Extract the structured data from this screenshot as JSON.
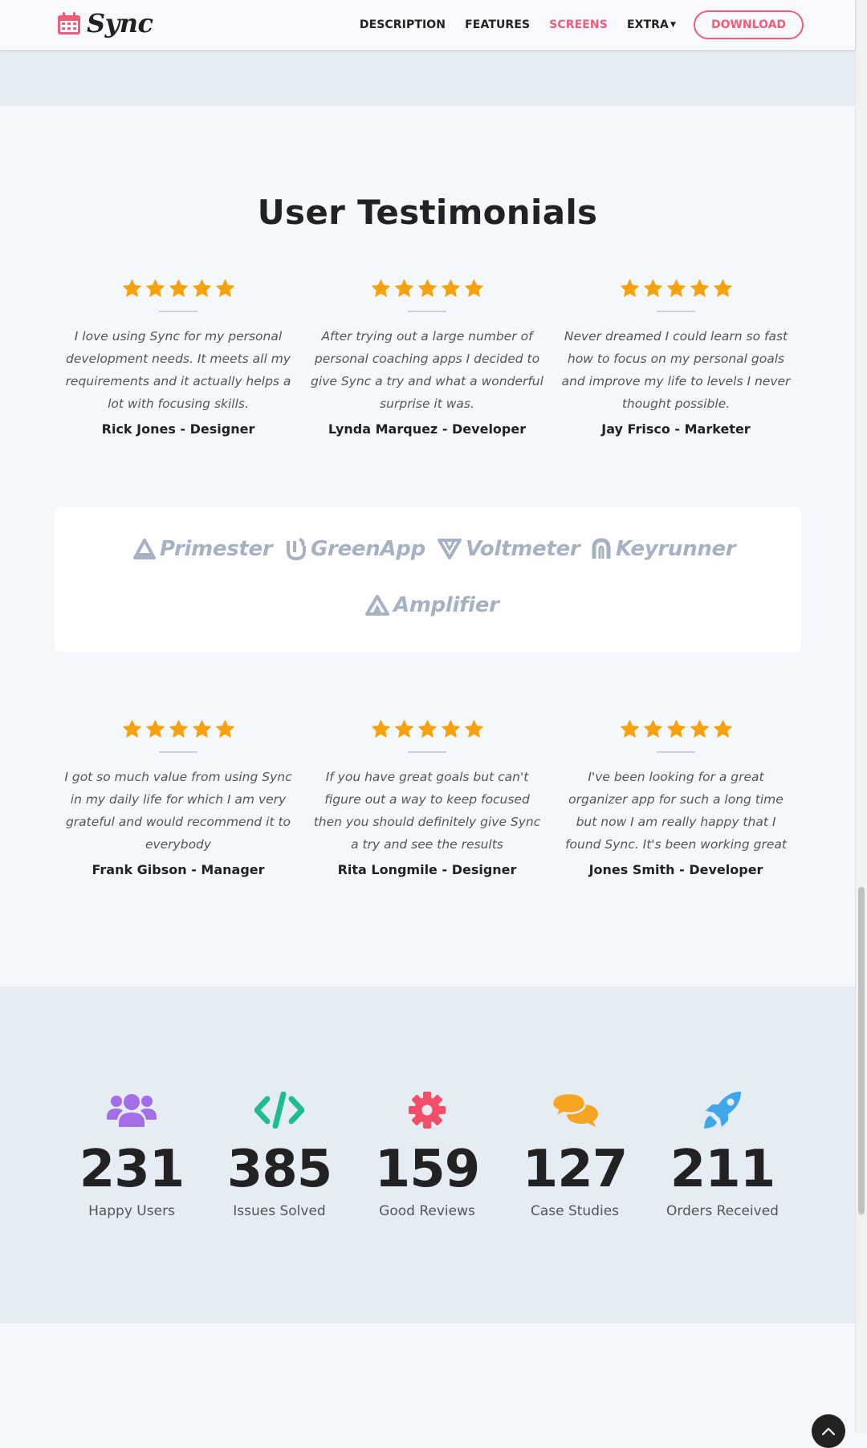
{
  "nav": {
    "brand": "Sync",
    "links": [
      "DESCRIPTION",
      "FEATURES",
      "SCREENS",
      "EXTRA"
    ],
    "active": "SCREENS",
    "download": "DOWNLOAD"
  },
  "testimonials": {
    "title": "User Testimonials",
    "items": [
      {
        "quote": "I love using Sync for my personal development needs. It meets all my requirements and it actually helps a lot with focusing skills.",
        "author": "Rick Jones - Designer",
        "stars": 5
      },
      {
        "quote": "After trying out a large number of personal coaching apps I decided to give Sync a try and what a wonderful surprise it was.",
        "author": "Lynda Marquez - Developer",
        "stars": 5
      },
      {
        "quote": "Never dreamed I could learn so fast how to focus on my personal goals and improve my life to levels I never thought possible.",
        "author": "Jay Frisco - Marketer",
        "stars": 5
      },
      {
        "quote": "I got so much value from using Sync in my daily life for which I am very grateful and would recommend it to everybody",
        "author": "Frank Gibson - Manager",
        "stars": 5
      },
      {
        "quote": "If you have great goals but can't figure out a way to keep focused then you should definitely give Sync a try and see the results",
        "author": "Rita Longmile - Designer",
        "stars": 5
      },
      {
        "quote": "I've been looking for a great organizer app for such a long time but now I am really happy that I found Sync. It's been working great",
        "author": "Jones Smith - Developer",
        "stars": 5
      }
    ]
  },
  "partners": [
    "Primester",
    "GreenApp",
    "Voltmeter",
    "Keyrunner",
    "Amplifier"
  ],
  "counters": [
    {
      "value": "231",
      "label": "Happy Users",
      "icon": "users-icon",
      "color": "#a36ee8"
    },
    {
      "value": "385",
      "label": "Issues Solved",
      "icon": "code-icon",
      "color": "#1fbd8e"
    },
    {
      "value": "159",
      "label": "Good Reviews",
      "icon": "gear-icon",
      "color": "#f24e68"
    },
    {
      "value": "127",
      "label": "Case Studies",
      "icon": "comments-icon",
      "color": "#f6a523"
    },
    {
      "value": "211",
      "label": "Orders Received",
      "icon": "rocket-icon",
      "color": "#3fa6e8"
    }
  ],
  "colors": {
    "accent": "#f25c78",
    "star": "#f6a20e",
    "logo": "#a5b2c4",
    "band": "#e5ecf4"
  }
}
